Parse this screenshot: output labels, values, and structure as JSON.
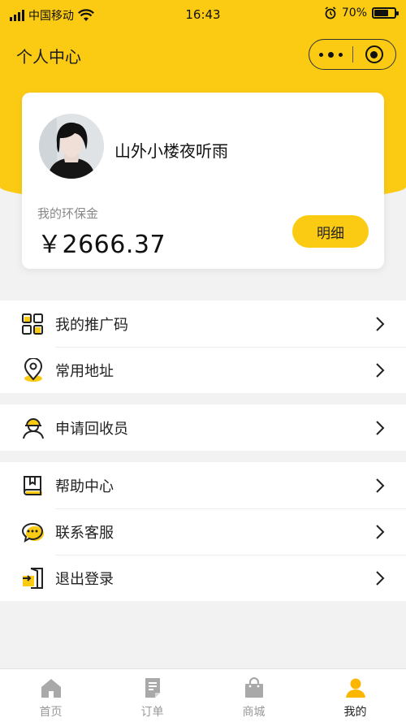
{
  "status_bar": {
    "carrier": "中国移动",
    "time": "16:43",
    "battery": "70%",
    "battery_level": 0.7
  },
  "header": {
    "title": "个人中心"
  },
  "user": {
    "name": "山外小楼夜听雨",
    "fund_label": "我的环保金",
    "fund_amount": "￥2666.37",
    "detail_button": "明细"
  },
  "menu": {
    "group1": [
      {
        "label": "我的推广码",
        "icon": "qrcode-icon"
      },
      {
        "label": "常用地址",
        "icon": "location-pin-icon"
      }
    ],
    "group2": [
      {
        "label": "申请回收员",
        "icon": "worker-icon"
      }
    ],
    "group3": [
      {
        "label": "帮助中心",
        "icon": "book-icon"
      },
      {
        "label": "联系客服",
        "icon": "chat-icon"
      },
      {
        "label": "退出登录",
        "icon": "logout-icon"
      }
    ]
  },
  "tabbar": {
    "tabs": [
      {
        "label": "首页",
        "icon": "home-icon"
      },
      {
        "label": "订单",
        "icon": "order-icon"
      },
      {
        "label": "商城",
        "icon": "shop-bag-icon"
      },
      {
        "label": "我的",
        "icon": "user-icon",
        "active": true
      }
    ]
  },
  "colors": {
    "accent": "#fbcb14",
    "background": "#f2f2f2",
    "inactive_tab": "#999999"
  }
}
